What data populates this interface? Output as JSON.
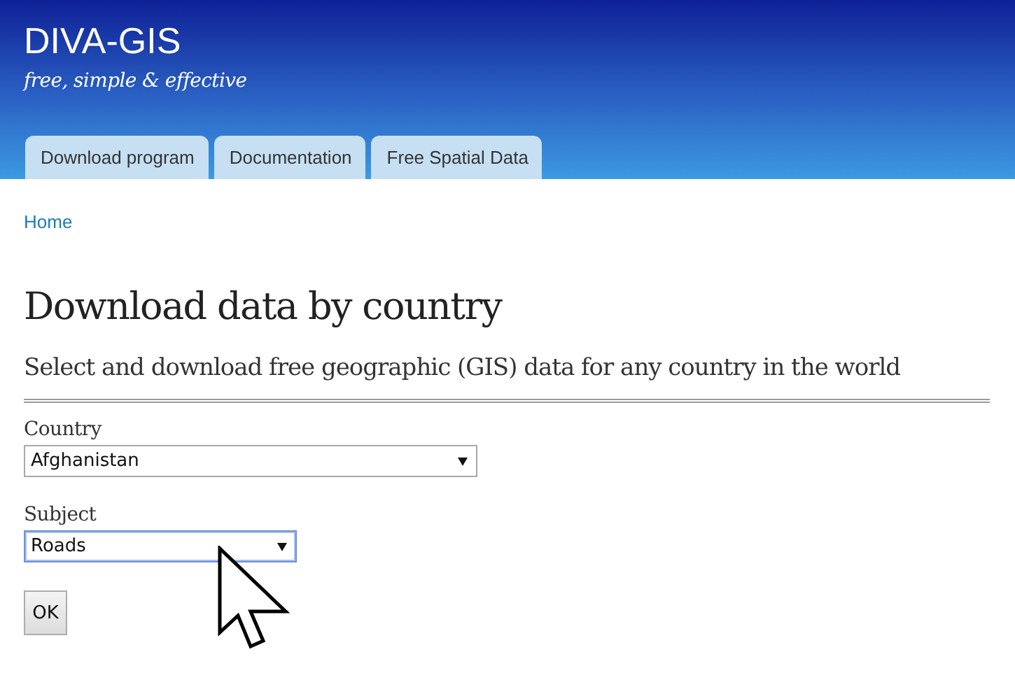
{
  "site": {
    "title": "DIVA-GIS",
    "tagline": "free, simple & effective"
  },
  "tabs": [
    {
      "label": "Download program",
      "selected": false
    },
    {
      "label": "Documentation",
      "selected": false
    },
    {
      "label": "Free Spatial Data",
      "selected": false
    }
  ],
  "breadcrumb": "Home",
  "heading": "Download data by country",
  "subtitle": "Select and download free geographic (GIS) data for any country in the world",
  "fields": [
    {
      "label": "Country",
      "value": "Afghanistan",
      "focused": false,
      "wide": true
    },
    {
      "label": "Subject",
      "value": "Roads",
      "focused": true,
      "wide": false
    }
  ],
  "button": "OK"
}
